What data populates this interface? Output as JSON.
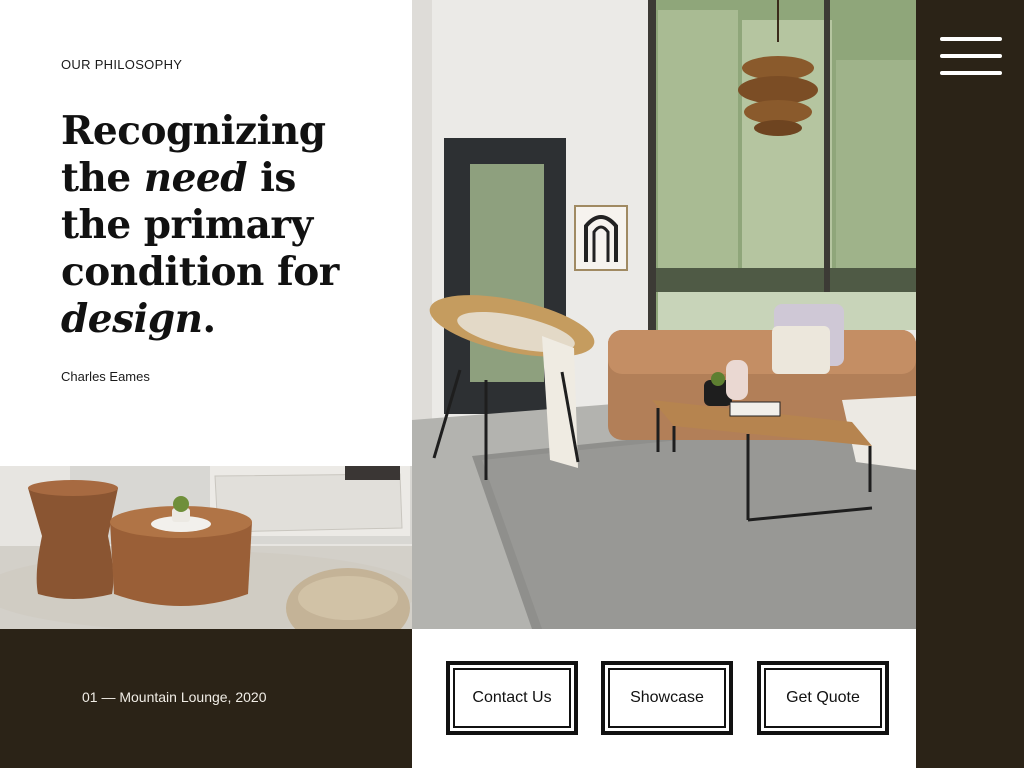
{
  "philosophy": {
    "eyebrow": "OUR PHILOSOPHY",
    "quote_line1": "Recognizing",
    "quote_line2_a": "the ",
    "quote_line2_em": "need",
    "quote_line2_b": " is",
    "quote_line3": "the primary",
    "quote_line4": "condition for",
    "quote_line5_em": "design",
    "quote_line5_b": ".",
    "author": "Charles Eames"
  },
  "caption": {
    "text": "01 — Mountain Lounge, 2020"
  },
  "buttons": {
    "contact_label": "Contact Us",
    "showcase_label": "Showcase",
    "quote_label": "Get Quote"
  },
  "icons": {
    "menu": "hamburger-menu-icon"
  },
  "colors": {
    "dark_panel": "#2b2317",
    "text": "#111111",
    "background": "#ffffff"
  }
}
